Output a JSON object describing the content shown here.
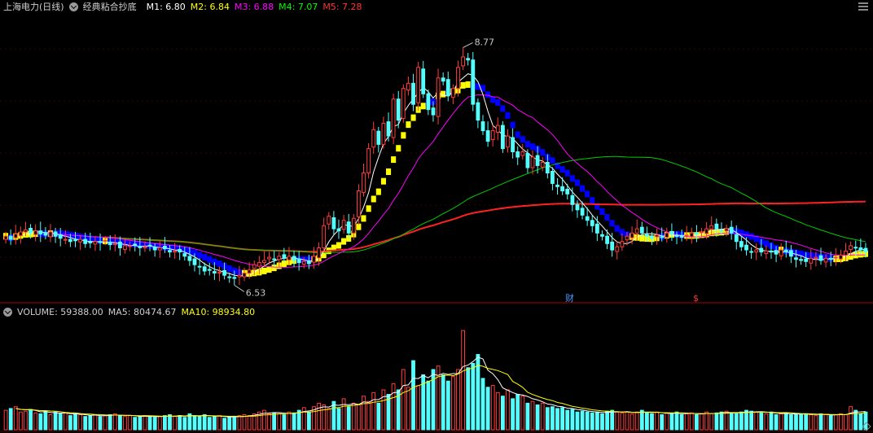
{
  "header": {
    "stock": "上海电力(日线)",
    "indicator": "经典粘合抄底",
    "m1_label": "M1: 6.80",
    "m1_color": "#ffffff",
    "m2_label": "M2: 6.84",
    "m2_color": "#ffff00",
    "m3_label": "M3: 6.88",
    "m3_color": "#ff00ff",
    "m4_label": "M4: 7.07",
    "m4_color": "#00ff00",
    "m5_label": "M5: 7.28",
    "m5_color": "#ff2222"
  },
  "volume_header": {
    "volume_label": "VOLUME: 59388.00",
    "ma5_label": "MA5: 80474.67",
    "ma10_label": "MA10: 98934.80",
    "ma10_color": "#ffff00"
  },
  "markers": {
    "high_label": "8.77",
    "low_label": "6.53",
    "event1": "财",
    "event2": "$"
  },
  "chart_data": {
    "type": "candlestick",
    "price_range": [
      6.35,
      9.05
    ],
    "volume_range": [
      0,
      125000
    ],
    "colors": {
      "up": "#ff3c3c",
      "down": "#54ffff"
    },
    "closes": [
      6.95,
      6.92,
      6.97,
      6.99,
      7.01,
      6.98,
      7.0,
      6.97,
      6.96,
      6.99,
      6.95,
      6.93,
      6.92,
      6.9,
      6.91,
      6.92,
      6.88,
      6.89,
      6.9,
      6.89,
      6.91,
      6.87,
      6.88,
      6.84,
      6.86,
      6.86,
      6.87,
      6.84,
      6.85,
      6.86,
      6.82,
      6.84,
      6.83,
      6.8,
      6.81,
      6.8,
      6.76,
      6.72,
      6.68,
      6.66,
      6.62,
      6.63,
      6.6,
      6.61,
      6.58,
      6.56,
      6.55,
      6.58,
      6.6,
      6.63,
      6.68,
      6.7,
      6.72,
      6.75,
      6.73,
      6.76,
      6.74,
      6.76,
      6.72,
      6.7,
      6.71,
      6.69,
      6.76,
      6.84,
      7.05,
      7.14,
      7.02,
      7.0,
      7.1,
      6.98,
      7.12,
      7.38,
      7.55,
      7.78,
      7.96,
      7.82,
      8.02,
      7.9,
      8.25,
      8.05,
      8.35,
      8.4,
      8.2,
      8.55,
      8.3,
      8.15,
      8.1,
      8.45,
      8.42,
      8.28,
      8.35,
      8.55,
      8.65,
      8.62,
      8.2,
      8.05,
      7.95,
      7.85,
      7.95,
      8.0,
      7.78,
      7.9,
      7.75,
      7.7,
      7.75,
      7.6,
      7.7,
      7.62,
      7.65,
      7.55,
      7.45,
      7.42,
      7.38,
      7.35,
      7.25,
      7.2,
      7.15,
      7.1,
      7.05,
      6.98,
      6.95,
      6.88,
      6.82,
      6.85,
      6.9,
      6.95,
      6.98,
      7.02,
      6.98,
      6.95,
      6.93,
      6.96,
      6.94,
      6.98,
      6.97,
      6.95,
      6.94,
      6.96,
      6.98,
      6.97,
      6.99,
      7.02,
      7.05,
      7.02,
      7.0,
      7.02,
      6.98,
      6.9,
      6.85,
      6.82,
      6.8,
      6.82,
      6.8,
      6.81,
      6.8,
      6.78,
      6.82,
      6.8,
      6.76,
      6.73,
      6.72,
      6.71,
      6.74,
      6.75,
      6.72,
      6.74,
      6.73,
      6.75,
      6.77,
      6.81,
      6.86,
      6.84,
      6.82,
      6.8
    ],
    "volumes": [
      22000,
      24000,
      26000,
      20000,
      21000,
      23000,
      19000,
      18000,
      21000,
      17000,
      20000,
      18000,
      19000,
      16000,
      18000,
      17000,
      15000,
      16000,
      17000,
      15000,
      16000,
      17000,
      18000,
      16000,
      15000,
      16000,
      14000,
      15000,
      16000,
      15000,
      14000,
      15000,
      16000,
      17000,
      15000,
      16000,
      14000,
      18000,
      16000,
      15000,
      17000,
      14000,
      15000,
      16000,
      13000,
      14000,
      15000,
      16000,
      17000,
      16000,
      18000,
      20000,
      22000,
      18000,
      19000,
      18000,
      17000,
      20000,
      19000,
      22000,
      25000,
      20000,
      26000,
      30000,
      28000,
      24000,
      32000,
      24000,
      35000,
      26000,
      30000,
      28000,
      38000,
      32000,
      42000,
      30000,
      45000,
      40000,
      52000,
      45000,
      68000,
      48000,
      78000,
      50000,
      62000,
      55000,
      68000,
      72000,
      62000,
      55000,
      60000,
      68000,
      112000,
      70000,
      75000,
      85000,
      58000,
      48000,
      50000,
      42000,
      38000,
      45000,
      35000,
      40000,
      38000,
      30000,
      32000,
      28000,
      30000,
      25000,
      26000,
      24000,
      25000,
      22000,
      23000,
      20000,
      21000,
      20000,
      19000,
      20000,
      18000,
      21000,
      22000,
      20000,
      19000,
      20000,
      18000,
      20000,
      22000,
      19000,
      18000,
      20000,
      17000,
      19000,
      18000,
      20000,
      17000,
      18000,
      19000,
      17000,
      18000,
      20000,
      18000,
      19000,
      20000,
      21000,
      19000,
      18000,
      20000,
      22000,
      21000,
      20000,
      19000,
      18000,
      20000,
      17000,
      18000,
      19000,
      17000,
      18000,
      17000,
      18000,
      17000,
      16000,
      18000,
      17000,
      16000,
      17000,
      18000,
      17000,
      26000,
      22000,
      18000,
      20000
    ]
  }
}
